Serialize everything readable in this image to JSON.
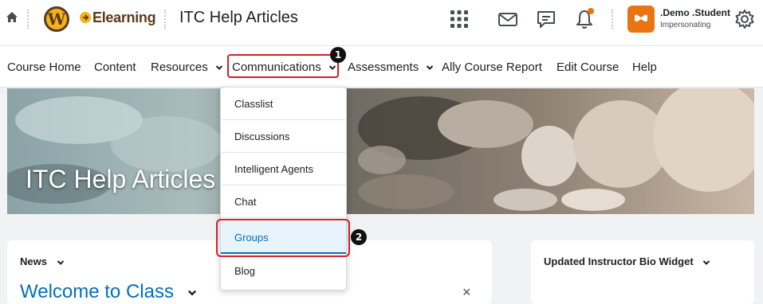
{
  "header": {
    "logo_letter": "W",
    "brand": "Elearning",
    "site_title": "ITC Help Articles",
    "user_name": ".Demo .Student",
    "user_status": "Impersonating",
    "icons": [
      "home-icon",
      "waffle-icon",
      "mail-icon",
      "chat-icon",
      "bell-icon",
      "gear-icon"
    ]
  },
  "nav": {
    "items": [
      {
        "label": "Course Home"
      },
      {
        "label": "Content"
      },
      {
        "label": "Resources"
      },
      {
        "label": "Communications"
      },
      {
        "label": "Assessments"
      },
      {
        "label": "Ally Course Report"
      },
      {
        "label": "Edit Course"
      },
      {
        "label": "Help"
      }
    ]
  },
  "banner": {
    "title": "ITC Help Articles"
  },
  "dropdown": {
    "items": [
      {
        "label": "Classlist"
      },
      {
        "label": "Discussions"
      },
      {
        "label": "Intelligent Agents"
      },
      {
        "label": "Chat"
      },
      {
        "label": "Groups"
      },
      {
        "label": "Blog"
      }
    ]
  },
  "callouts": {
    "one": "1",
    "two": "2"
  },
  "news": {
    "label": "News",
    "headline": "Welcome to Class",
    "close": "×"
  },
  "widget": {
    "label": "Updated Instructor Bio Widget"
  },
  "colors": {
    "accent": "#006fbf",
    "highlight": "#d0202a",
    "brand": "#f5b21b",
    "avatar": "#e87511"
  }
}
